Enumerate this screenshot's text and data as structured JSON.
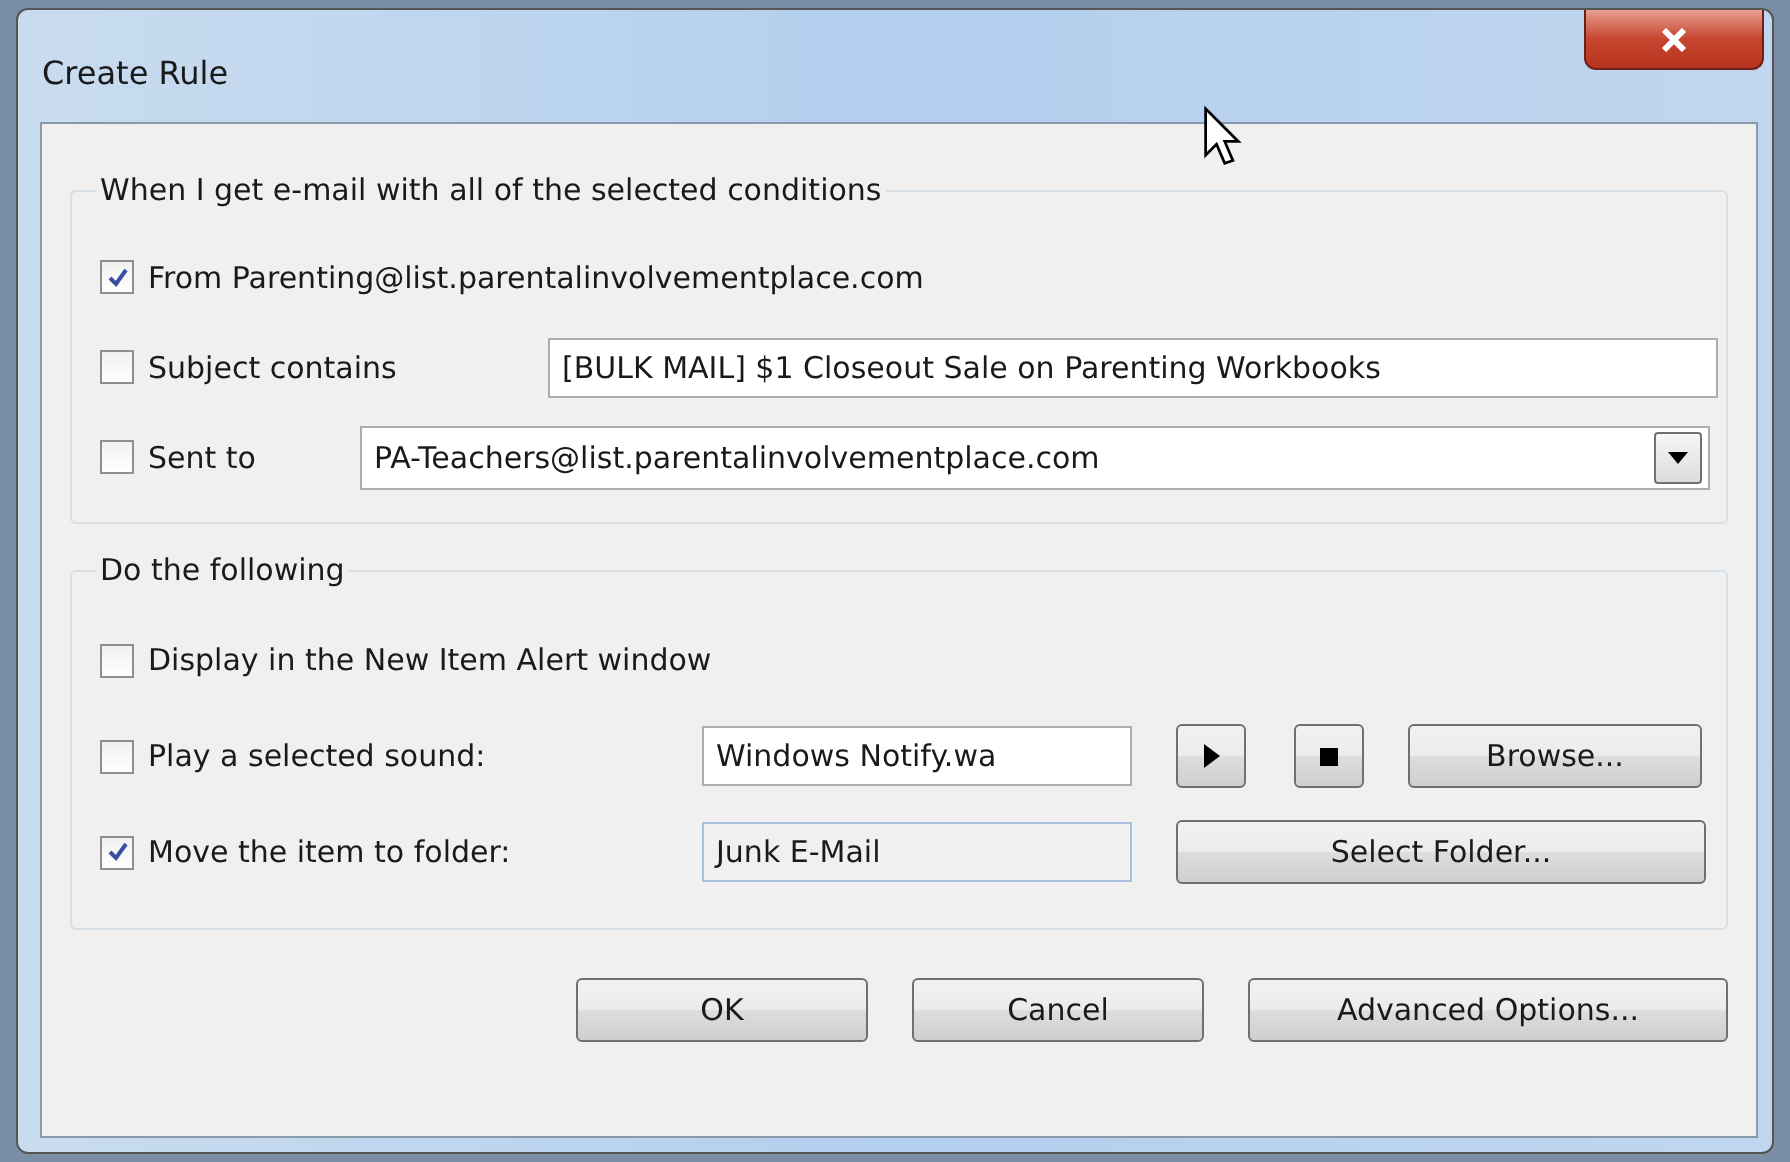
{
  "window": {
    "title": "Create Rule"
  },
  "conditions": {
    "legend": "When I get e-mail with all of the selected conditions",
    "items": [
      {
        "kind": "plain",
        "label": "From Parenting@list.parentalinvolvementplace.com",
        "checked": true
      },
      {
        "kind": "text",
        "label": "Subject contains",
        "checked": false,
        "value": "[BULK MAIL] $1 Closeout Sale on Parenting Workbooks"
      },
      {
        "kind": "combo",
        "label": "Sent to",
        "checked": false,
        "value": "PA-Teachers@list.parentalinvolvementplace.com"
      }
    ]
  },
  "actions": {
    "legend": "Do the following",
    "items": [
      {
        "kind": "plain",
        "label": "Display in the New Item Alert window",
        "checked": false
      },
      {
        "kind": "sound",
        "label": "Play a selected sound:",
        "checked": false,
        "value": "Windows Notify.wa",
        "button": "Browse..."
      },
      {
        "kind": "folder",
        "label": "Move the item to folder:",
        "checked": true,
        "value": "Junk E-Mail",
        "button": "Select Folder..."
      }
    ]
  },
  "buttons": [
    "OK",
    "Cancel",
    "Advanced Options..."
  ]
}
